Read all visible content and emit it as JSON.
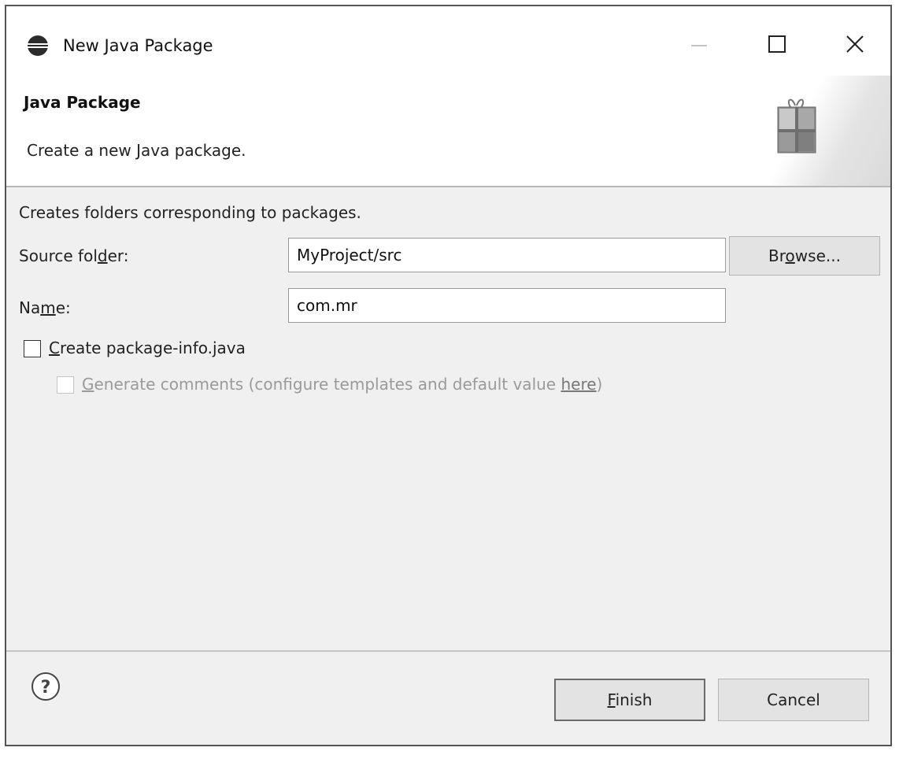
{
  "window": {
    "title": "New Java Package",
    "icons": {
      "app": "eclipse-icon",
      "minimize": "minimize-icon",
      "maximize": "maximize-icon",
      "close": "close-icon"
    }
  },
  "banner": {
    "title": "Java Package",
    "description": "Create a new Java package.",
    "icon": "package-wizard-icon"
  },
  "form": {
    "intro": "Creates folders corresponding to packages.",
    "source_folder": {
      "label_pre": "Source fol",
      "label_mnemonic": "d",
      "label_post": "er:",
      "value": "MyProject/src"
    },
    "browse_button": {
      "pre": "Br",
      "mnemonic": "o",
      "post": "wse..."
    },
    "name": {
      "label_pre": "Na",
      "label_mnemonic": "m",
      "label_post": "e:",
      "value": "com.mr"
    },
    "create_package_info": {
      "mnemonic": "C",
      "label_rest": "reate package-info.java",
      "checked": false
    },
    "generate_comments": {
      "mnemonic": "G",
      "label_rest": "enerate comments",
      "hint_pre": " (configure templates and default value ",
      "hint_link": "here",
      "hint_post": ")",
      "checked": false,
      "enabled": false
    }
  },
  "footer": {
    "help_icon": "help-icon",
    "finish": {
      "mnemonic": "F",
      "rest": "inish"
    },
    "cancel": "Cancel"
  }
}
